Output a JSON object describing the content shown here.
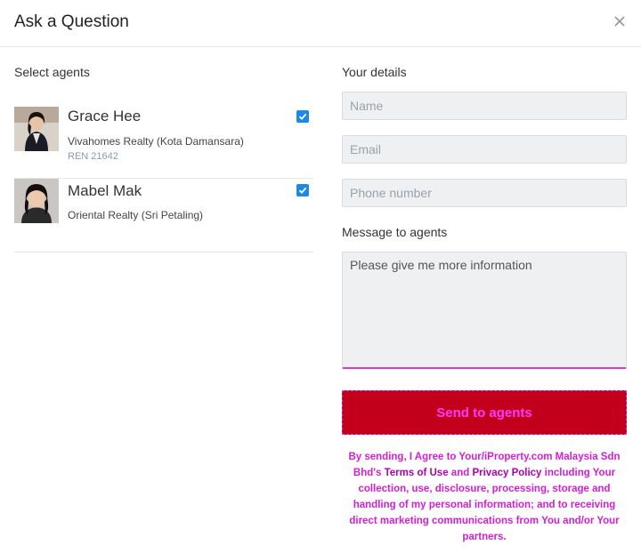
{
  "dialog": {
    "title": "Ask a Question",
    "close_icon": "close-icon"
  },
  "agents_section": {
    "label": "Select agents",
    "agents": [
      {
        "name": "Grace Hee",
        "agency": "Vivahomes Realty (Kota Damansara)",
        "ren": "REN 21642",
        "selected": true
      },
      {
        "name": "Mabel Mak",
        "agency": "Oriental Realty (Sri Petaling)",
        "selected": true
      }
    ]
  },
  "details_section": {
    "label": "Your details",
    "name_placeholder": "Name",
    "email_placeholder": "Email",
    "phone_placeholder": "Phone number",
    "message_label": "Message to agents",
    "message_value": "Please give me more information"
  },
  "send_button": "Send to agents",
  "legal": {
    "prefix": "By sending, I Agree to Your/iProperty.com Malaysia Sdn Bhd's ",
    "terms_link": "Terms of Use",
    "and": " and ",
    "privacy_link": "Privacy Policy",
    "suffix": " including Your collection, use, disclosure, processing, storage and handling of my personal information; and to receiving direct marketing communications from You and/or Your partners."
  },
  "colors": {
    "accent_red": "#c3001c",
    "checkbox_blue": "#1e88e5",
    "highlight_magenta": "#d63ad6"
  }
}
